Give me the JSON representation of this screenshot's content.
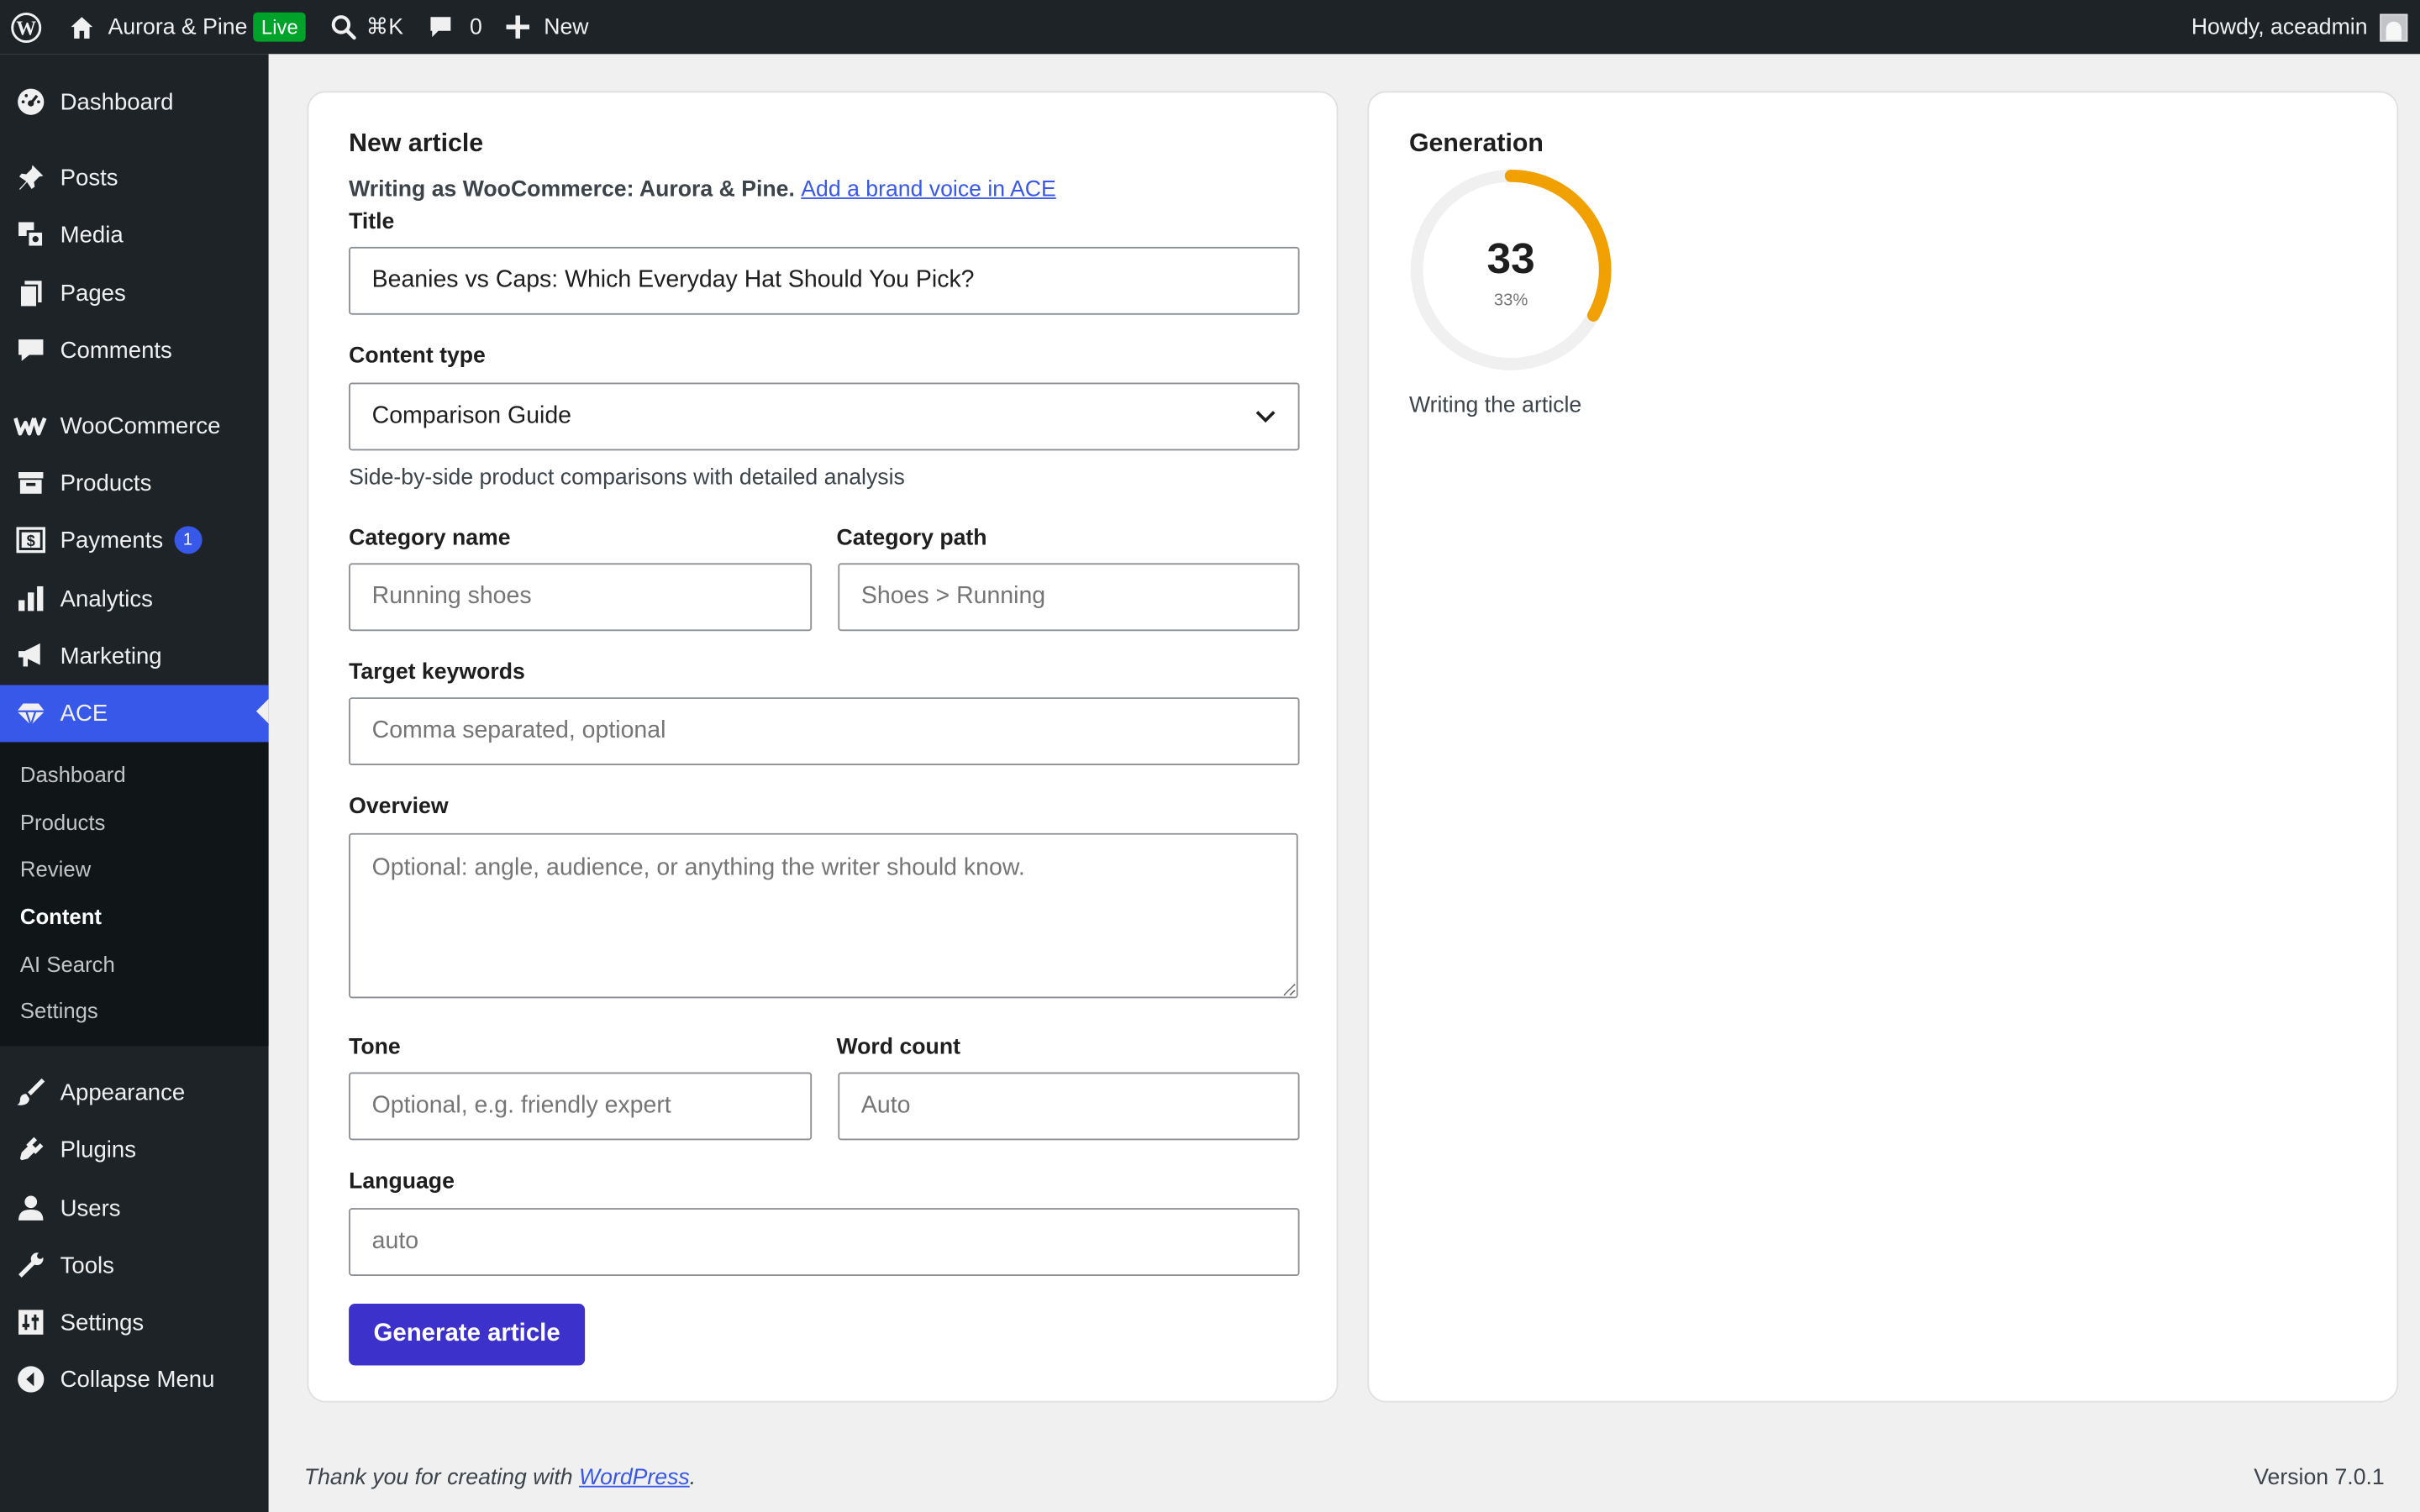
{
  "admin_bar": {
    "site_name": "Aurora & Pine",
    "live_badge": "Live",
    "search_shortcut": "⌘K",
    "comments_count": "0",
    "new_label": "New",
    "howdy": "Howdy, aceadmin"
  },
  "sidebar": {
    "items": [
      {
        "label": "Dashboard",
        "icon": "dashboard-icon"
      },
      {
        "label": "Posts",
        "icon": "pushpin-icon"
      },
      {
        "label": "Media",
        "icon": "media-icon"
      },
      {
        "label": "Pages",
        "icon": "pages-icon"
      },
      {
        "label": "Comments",
        "icon": "comment-icon"
      },
      {
        "label": "WooCommerce",
        "icon": "woocommerce-icon"
      },
      {
        "label": "Products",
        "icon": "archive-icon"
      },
      {
        "label": "Payments",
        "icon": "dollar-icon",
        "badge": "1"
      },
      {
        "label": "Analytics",
        "icon": "bar-chart-icon"
      },
      {
        "label": "Marketing",
        "icon": "megaphone-icon"
      },
      {
        "label": "ACE",
        "icon": "diamond-icon"
      },
      {
        "label": "Appearance",
        "icon": "paintbrush-icon"
      },
      {
        "label": "Plugins",
        "icon": "plug-icon"
      },
      {
        "label": "Users",
        "icon": "user-icon"
      },
      {
        "label": "Tools",
        "icon": "wrench-icon"
      },
      {
        "label": "Settings",
        "icon": "sliders-icon"
      },
      {
        "label": "Collapse Menu",
        "icon": "collapse-icon"
      }
    ],
    "submenu": [
      "Dashboard",
      "Products",
      "Review",
      "Content",
      "AI Search",
      "Settings"
    ],
    "current_submenu": "Content"
  },
  "form": {
    "heading": "New article",
    "voice_text": "Writing as WooCommerce: Aurora & Pine.",
    "voice_link": "Add a brand voice in ACE",
    "title_label": "Title",
    "title_value": "Beanies vs Caps: Which Everyday Hat Should You Pick?",
    "content_type_label": "Content type",
    "content_type_value": "Comparison Guide",
    "content_type_help": "Side-by-side product comparisons with detailed analysis",
    "category_name_label": "Category name",
    "category_name_placeholder": "Running shoes",
    "category_path_label": "Category path",
    "category_path_placeholder": "Shoes > Running",
    "keywords_label": "Target keywords",
    "keywords_placeholder": "Comma separated, optional",
    "overview_label": "Overview",
    "overview_placeholder": "Optional: angle, audience, or anything the writer should know.",
    "tone_label": "Tone",
    "tone_placeholder": "Optional, e.g. friendly expert",
    "word_count_label": "Word count",
    "word_count_placeholder": "Auto",
    "language_label": "Language",
    "language_placeholder": "auto",
    "submit_label": "Generate article"
  },
  "generation": {
    "heading": "Generation",
    "value": "33",
    "percent_label": "33%",
    "progress_fraction": 0.33,
    "status": "Writing the article",
    "ring_color": "#f0a000",
    "track_color": "#f0f0f0"
  },
  "footer": {
    "thanks_prefix": "Thank you for creating with",
    "link": "WordPress",
    "suffix": ".",
    "version": "Version 7.0.1"
  },
  "colors": {
    "accent": "#3858e9",
    "button": "#3d31cc",
    "admin_dark": "#1d2327",
    "live_green": "#00a32a"
  }
}
